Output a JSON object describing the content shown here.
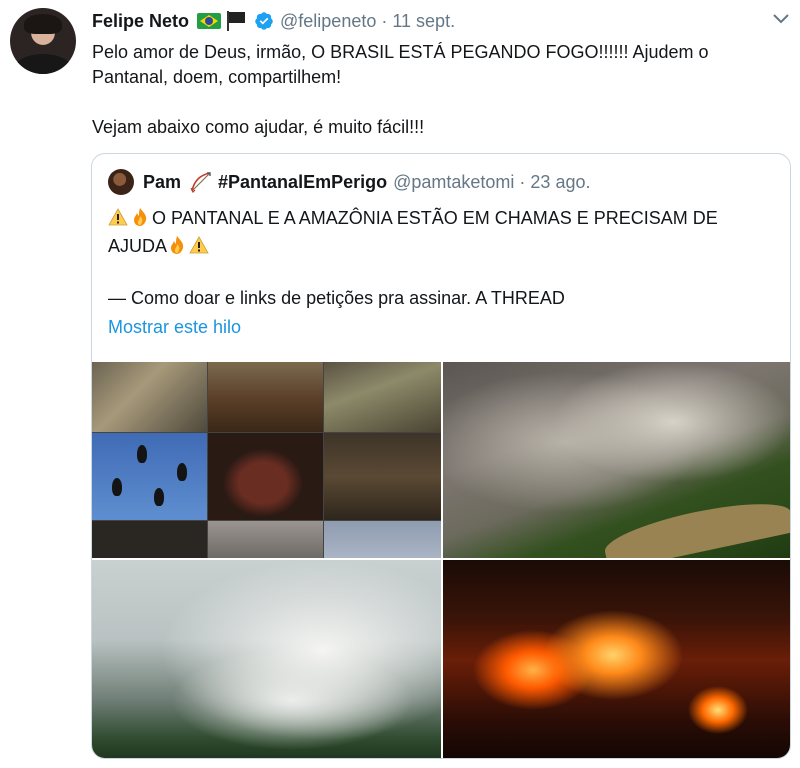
{
  "tweet": {
    "author_name": "Felipe Neto",
    "handle": "@felipeneto",
    "separator": "·",
    "date": "11 sept.",
    "text_line1": "Pelo amor de Deus, irmão, O BRASIL ESTÁ PEGANDO FOGO!!!!!! Ajudem o Pantanal, doem, compartilhem!",
    "text_line2": "Vejam abaixo como ajudar, é muito fácil!!!",
    "icons": [
      "brazil-flag-icon",
      "black-flag-icon",
      "verified-badge-icon",
      "chevron-down-icon"
    ],
    "colors": {
      "verified": "#1da1f2",
      "link": "#1b95e0",
      "muted": "#657786",
      "border": "#ccd6dd"
    }
  },
  "quoted": {
    "author_name": "Pam",
    "hashtag": "#PantanalEmPerigo",
    "handle": "@pamtaketomi",
    "separator": "·",
    "date": "23 ago.",
    "body_main": "O PANTANAL E A AMAZÔNIA ESTÃO EM CHAMAS E PRECISAM DE AJUDA",
    "body_line2": "— Como doar e links de petições pra assinar. A THREAD",
    "show_thread": "Mostrar este hilo",
    "icons": [
      "bow-and-arrow-icon",
      "warning-icon",
      "fire-icon"
    ],
    "media": [
      "animals-collage-image",
      "forest-fire-aerial-image",
      "smoke-over-forest-image",
      "night-fire-image"
    ]
  }
}
